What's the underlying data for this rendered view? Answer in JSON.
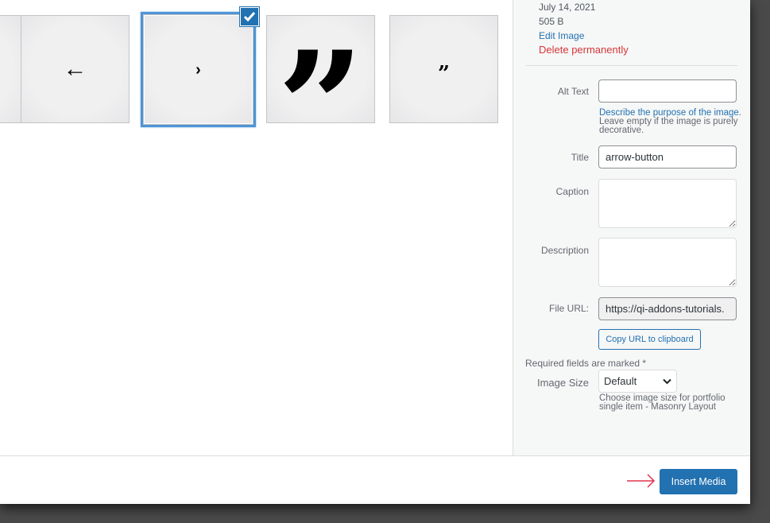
{
  "attachments": [
    {
      "name": "partial-thumbnail",
      "glyph": "",
      "selected": false
    },
    {
      "name": "left-arrow-thumbnail",
      "glyph": "←",
      "selected": false
    },
    {
      "name": "arrow-button-thumbnail",
      "glyph": "›",
      "selected": true
    },
    {
      "name": "large-quote-thumbnail",
      "glyph": "”",
      "selected": false
    },
    {
      "name": "small-quote-thumbnail",
      "glyph": "”",
      "selected": false
    }
  ],
  "details": {
    "date": "July 14, 2021",
    "file_size": "505 B",
    "edit_link": "Edit Image",
    "delete_link": "Delete permanently"
  },
  "fields": {
    "alt_text": {
      "label": "Alt Text",
      "value": ""
    },
    "alt_help_link": "Describe the purpose of the image",
    "alt_help_rest": ". Leave empty if the image is purely decorative.",
    "title": {
      "label": "Title",
      "value": "arrow-button"
    },
    "caption": {
      "label": "Caption",
      "value": ""
    },
    "description": {
      "label": "Description",
      "value": ""
    },
    "file_url": {
      "label": "File URL:",
      "value": "https://qi-addons-tutorials."
    },
    "copy_button": "Copy URL to clipboard",
    "required_note": "Required fields are marked *",
    "image_size": {
      "label": "Image Size",
      "value": "Default",
      "help": "Choose image size for portfolio single item - Masonry Layout"
    }
  },
  "toolbar": {
    "insert_label": "Insert Media"
  },
  "colors": {
    "primary": "#2271b1",
    "delete": "#d63638",
    "annotation_arrow": "#e0334f",
    "selection": "#4f94d4"
  }
}
